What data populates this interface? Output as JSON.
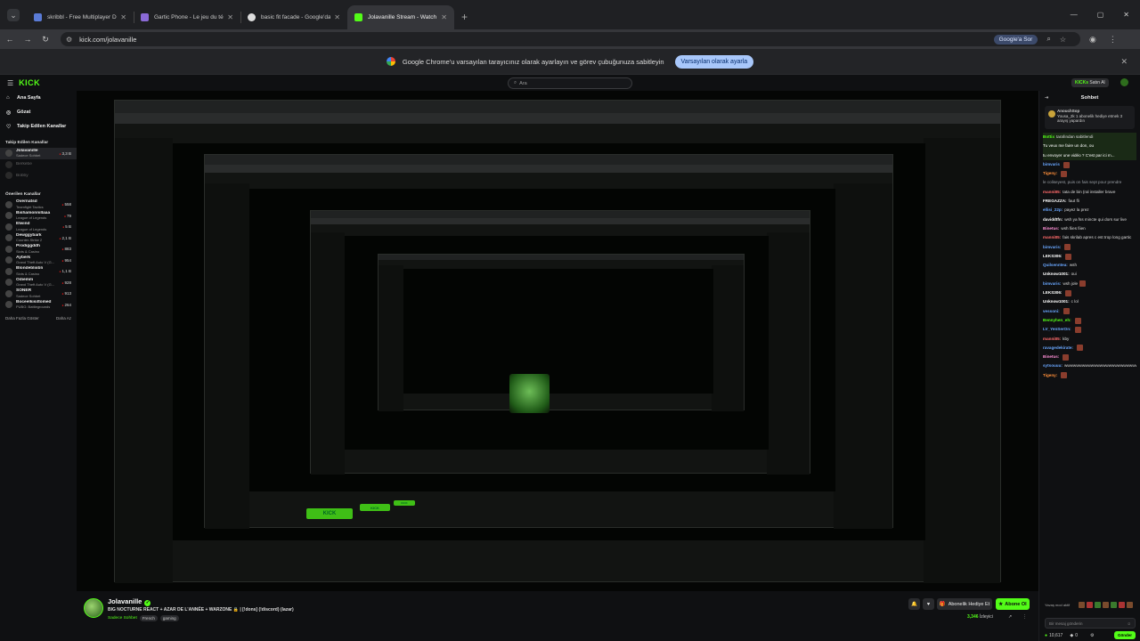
{
  "browser": {
    "tabs": [
      {
        "title": "skribbl - Free Multiplayer Drawi",
        "color": "#5a7bd6"
      },
      {
        "title": "Gartic Phone - Le jeu du télépho",
        "color": "#8a6ad6"
      },
      {
        "title": "basic fit facade - Google'da Ara",
        "color": "#dddddd"
      },
      {
        "title": "Jolavanille Stream - Watch Live",
        "color": "#53fc18"
      }
    ],
    "url": "kick.com/jolavanille",
    "google_sor": "Google'a Sor",
    "infobar_text": "Google Chrome'u varsayılan tarayıcınız olarak ayarlayın ve görev çubuğunuza sabitleyin",
    "infobar_button": "Varsayılan olarak ayarla"
  },
  "kick": {
    "logo": "KICK",
    "search_placeholder": "Ara",
    "kicks_label": "KICKs",
    "kicks_buy": "Satın Al",
    "nav": [
      {
        "label": "Ana Sayfa",
        "icon": "home-icon"
      },
      {
        "label": "Gözat",
        "icon": "compass-icon"
      },
      {
        "label": "Takip Edilen Kanallar",
        "icon": "heart-icon"
      }
    ],
    "followed_heading": "Takip Edilen Kanallar",
    "followed": [
      {
        "name": "Jolavanille",
        "sub": "Sadece Sohbet",
        "viewers": "3,3 B",
        "live": true
      },
      {
        "name": "Berkebe",
        "sub": "",
        "viewers": "",
        "live": false
      },
      {
        "name": "Bobby",
        "sub": "",
        "viewers": "",
        "live": false
      }
    ],
    "recommended_heading": "Önerilen Kanallar",
    "recommended": [
      {
        "name": "Overnatsd",
        "sub": "Teamfight Tactics",
        "viewers": "558"
      },
      {
        "name": "Bishamonnillaaa",
        "sub": "League of Legends",
        "viewers": "79"
      },
      {
        "name": "Elwind",
        "sub": "League of Legends",
        "viewers": "5 B"
      },
      {
        "name": "Dewggybark",
        "sub": "Counter-Strike 2",
        "viewers": "2,1 B"
      },
      {
        "name": "Prodiggddh",
        "sub": "Slots & Casino",
        "viewers": "883"
      },
      {
        "name": "Ayberk",
        "sub": "Grand Theft Auto V (G...",
        "viewers": "954"
      },
      {
        "name": "Blondebliiibli",
        "sub": "Slots & Casino",
        "viewers": "1,1 B"
      },
      {
        "name": "Odiemm",
        "sub": "Grand Theft Auto V (G...",
        "viewers": "928"
      },
      {
        "name": "SONER",
        "sub": "Sadece Sohbet",
        "viewers": "913"
      },
      {
        "name": "Boceelkisiltomed",
        "sub": "PUBG: Battlegrounds",
        "viewers": "264"
      }
    ],
    "show_more": "Daha Fazla Göster",
    "show_less": "Daha Az"
  },
  "stream": {
    "channel": "Jolavanille",
    "title": "BIG NOCTURNE REACT + AZAR DE L'ANNÉE + WARZONE 🔒 | [!dons] (!discord) (lazar)",
    "category": "Sadece Sohbet",
    "tags": [
      "French",
      "gaming"
    ],
    "gift_button": "Abonelik Hediye Et",
    "sub_button": "Abone Ol",
    "viewers": "3,346",
    "viewers_label": "İzleyici",
    "uptime": ""
  },
  "chat": {
    "heading": "Sohbet",
    "pinned_user": "AnouchSop",
    "pinned_text": "Yousa_2k  1 abonelik hediye etmek 3 arayış yapardın",
    "messages": [
      {
        "user": "Bottix",
        "text": "tarafından sabitlendi",
        "color": "#53fc18",
        "hl": true
      },
      {
        "user": "",
        "text": "Tu veux me faire un don, ou",
        "color": "#ffffff",
        "hl": true
      },
      {
        "user": "",
        "text": "tu envoyer une vidéo ? C'est par ici m...",
        "color": "#ffffff",
        "hl": true
      },
      {
        "user": "bimvaris",
        "text": "",
        "color": "#6aa7ff",
        "emote": true
      },
      {
        "user": "Tigeny:",
        "text": "",
        "color": "#ff8f3a",
        "emote": true
      },
      {
        "user": "",
        "text": "le coliseyest, puis on fais sept pour prendre",
        "color": "#9aa0a6"
      },
      {
        "user": "manni85:",
        "text": "tata de bin (ral installer brave",
        "color": "#ff6a6a"
      },
      {
        "user": "FREGAZZA:",
        "text": "faut fli",
        "color": "#ffffff"
      },
      {
        "user": "ellisi_22p:",
        "text": "payez la prez",
        "color": "#6aa7ff"
      },
      {
        "user": "daviddtfn:",
        "text": "wsh ya fss mincte qui dors sur live",
        "color": "#ffffff"
      },
      {
        "user": "Binetus:",
        "text": "wsh fiies fiien",
        "color": "#ff8fd6"
      },
      {
        "user": "manni85:",
        "text": "fais skrilab apres c est trop long gartic",
        "color": "#ff6a6a"
      },
      {
        "user": "bimvaris:",
        "text": "",
        "color": "#6aa7ff",
        "emote": true
      },
      {
        "user": "LEKS306:",
        "text": "",
        "color": "#ffffff",
        "emote": true
      },
      {
        "user": "Quilsenntea:",
        "text": "wsh",
        "color": "#6aa7ff"
      },
      {
        "user": "Unknow1001:",
        "text": "oui",
        "color": "#ffffff"
      },
      {
        "user": "bimvaris:",
        "text": "wsh jole",
        "color": "#6aa7ff",
        "emote": true
      },
      {
        "user": "LEKS306:",
        "text": "",
        "color": "#ffffff",
        "emote": true
      },
      {
        "user": "Unknow1001:",
        "text": "c lol",
        "color": "#ffffff"
      },
      {
        "user": "vessoni:",
        "text": "",
        "color": "#6aa7ff",
        "emote": true
      },
      {
        "user": "Bennyhen_eh:",
        "text": "",
        "color": "#53fc18",
        "emote": true
      },
      {
        "user": "LV_YenSerOn:",
        "text": "",
        "color": "#6aa7ff",
        "emote": true
      },
      {
        "user": "manni85:",
        "text": "kby",
        "color": "#ff6a6a"
      },
      {
        "user": "ravagedekirate:",
        "text": "",
        "color": "#6aa7ff",
        "emote": true
      },
      {
        "user": "Binetus:",
        "text": "",
        "color": "#ff8fd6",
        "emote": true
      },
      {
        "user": "sytsouuu:",
        "text": "wwwwwwwwwwwwwwwwwwwwwwwww",
        "color": "#6aa7ff"
      },
      {
        "user": "Tigeny:",
        "text": "",
        "color": "#ff8f3a",
        "emote": true
      }
    ],
    "emote_label": "Yavaş mod aktif",
    "input_placeholder": "Bir mesaj gönderin",
    "kicks_balance": "10,617",
    "zero": "0",
    "send": "Gönder"
  },
  "colors": {
    "accent": "#53fc18",
    "background": "#0f1012"
  }
}
